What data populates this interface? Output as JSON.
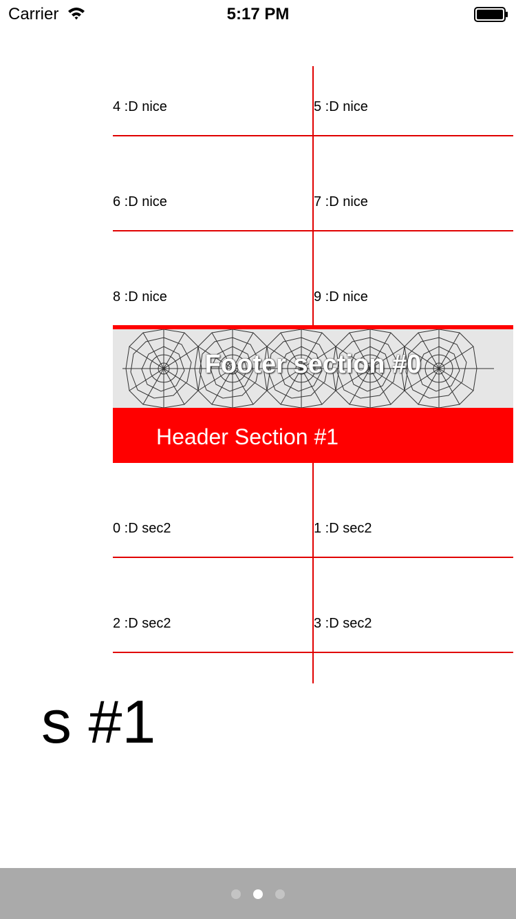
{
  "status_bar": {
    "carrier": "Carrier",
    "time": "5:17 PM",
    "wifi_icon": "wifi-icon",
    "battery_icon": "battery-icon"
  },
  "grid": {
    "section0_cells": [
      "4 :D nice",
      "5 :D nice",
      "6 :D nice",
      "7 :D nice",
      "8 :D nice",
      "9 :D nice"
    ],
    "section1_cells": [
      "0 :D sec2",
      "1 :D sec2",
      "2 :D sec2",
      "3 :D sec2"
    ],
    "footer_label": "Footer section #0",
    "header_label": "Header Section #1"
  },
  "page_label": "s #1",
  "page_control": {
    "pages": 3,
    "current_page": 2
  },
  "colors": {
    "accent": "#ff0000",
    "divider": "#e00000",
    "bottom_bar": "#aaaaaa"
  }
}
